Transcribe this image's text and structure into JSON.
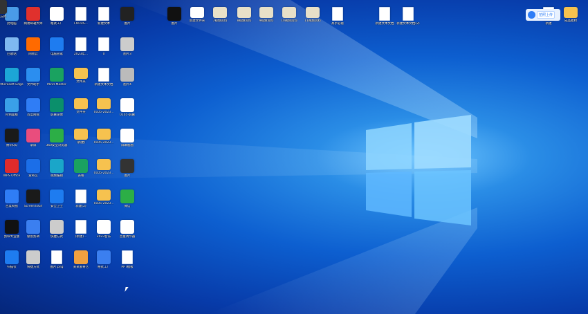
{
  "desktop_icons": [
    {
      "label": "此电脑",
      "icon": "computer-icon",
      "color": "#4a9be8"
    },
    {
      "label": "网易邮箱大师",
      "icon": "mail-icon",
      "color": "#e0312d"
    },
    {
      "label": "格式工厂",
      "icon": "factory-icon",
      "color": "#ffffff"
    },
    {
      "label": "FOCUS...",
      "icon": "document-icon",
      "color": "#ffffff"
    },
    {
      "label": "新建文本",
      "icon": "document-icon",
      "color": "#ffffff"
    },
    {
      "label": "图片",
      "icon": "phone-icon",
      "color": "#222222"
    },
    {
      "label": "回收站",
      "icon": "recycle-bin-icon",
      "color": "#7fb8f0"
    },
    {
      "label": "网易云",
      "icon": "music-icon",
      "color": "#ff6a00"
    },
    {
      "label": "电脑管家",
      "icon": "shield-icon",
      "color": "#1e7cf0"
    },
    {
      "label": "2023年...",
      "icon": "document-icon",
      "color": "#ffffff"
    },
    {
      "label": "0",
      "icon": "document-icon",
      "color": "#ffffff"
    },
    {
      "label": "图片3",
      "icon": "image-icon",
      "color": "#cccccc"
    },
    {
      "label": "Microsoft Edge",
      "icon": "edge-icon",
      "color": "#1ca6d6"
    },
    {
      "label": "文件助手",
      "icon": "link-icon",
      "color": "#2b8ef0"
    },
    {
      "label": "Mind Master",
      "icon": "mindmap-icon",
      "color": "#1aa260"
    },
    {
      "label": "文件夹",
      "icon": "folder-icon",
      "color": "#f6c24f"
    },
    {
      "label": "新建文本文档",
      "icon": "document-icon",
      "color": "#ffffff"
    },
    {
      "label": "图片4",
      "icon": "phone-icon",
      "color": "#bbbbbb"
    },
    {
      "label": "控制面板",
      "icon": "control-panel-icon",
      "color": "#3aa0e8"
    },
    {
      "label": "百度网盘",
      "icon": "cloud-icon",
      "color": "#2f7df6"
    },
    {
      "label": "屏幕录像",
      "icon": "monitor-icon",
      "color": "#0b8f6b"
    },
    {
      "label": "文件夹",
      "icon": "folder-icon",
      "color": "#f6c24f"
    },
    {
      "label": "0105-2023...",
      "icon": "folder-icon",
      "color": "#f6c24f"
    },
    {
      "label": "0105-屏幕",
      "icon": "laptop-icon",
      "color": "#ffffff"
    },
    {
      "label": "腾讯QQ",
      "icon": "qq-icon",
      "color": "#1a1a1a"
    },
    {
      "label": "录屏",
      "icon": "record-icon",
      "color": "#e94d7d"
    },
    {
      "label": "360安全浏览器",
      "icon": "browser-icon",
      "color": "#2cae46"
    },
    {
      "label": "(新建)",
      "icon": "folder-icon",
      "color": "#f6c24f"
    },
    {
      "label": "0105-2023...",
      "icon": "folder-icon",
      "color": "#f6c24f"
    },
    {
      "label": "屏幕截图",
      "icon": "laptop-icon",
      "color": "#ffffff"
    },
    {
      "label": "WPS Office",
      "icon": "wps-icon",
      "color": "#e02b2b"
    },
    {
      "label": "爱奇艺",
      "icon": "video-icon",
      "color": "#1b6ee8"
    },
    {
      "label": "视频编辑",
      "icon": "video-edit-icon",
      "color": "#1aa6c9"
    },
    {
      "label": "表格",
      "icon": "spreadsheet-icon",
      "color": "#1aa260"
    },
    {
      "label": "0105-2023...",
      "icon": "folder-icon",
      "color": "#f6c24f"
    },
    {
      "label": "图片",
      "icon": "phone-icon",
      "color": "#333333"
    },
    {
      "label": "百度网盘",
      "icon": "cloud-icon",
      "color": "#2f7df6"
    },
    {
      "label": "ScreenToGif",
      "icon": "monitor-icon",
      "color": "#1a1a1a"
    },
    {
      "label": "安全卫士",
      "icon": "shield-icon",
      "color": "#1e7cf0"
    },
    {
      "label": "新建(2)",
      "icon": "document-icon",
      "color": "#ffffff"
    },
    {
      "label": "0105-2023...",
      "icon": "folder-icon",
      "color": "#f6c24f"
    },
    {
      "label": "微信",
      "icon": "wechat-icon",
      "color": "#2cae46"
    },
    {
      "label": "剪映专业版",
      "icon": "capcut-icon",
      "color": "#111111"
    },
    {
      "label": "极客剪辑",
      "icon": "editor-icon",
      "color": "#3b7ff0"
    },
    {
      "label": "快捷方式",
      "icon": "shortcut-icon",
      "color": "#cccccc"
    },
    {
      "label": "(新建)...",
      "icon": "document-icon",
      "color": "#ffffff"
    },
    {
      "label": "2023音乐",
      "icon": "speaker-icon",
      "color": "#ffffff"
    },
    {
      "label": "音量调节器",
      "icon": "speaker-icon",
      "color": "#ffffff"
    },
    {
      "label": "扫描仪",
      "icon": "scanner-icon",
      "color": "#1e7cf0"
    },
    {
      "label": "快捷方式",
      "icon": "shortcut-icon",
      "color": "#cccccc"
    },
    {
      "label": "图片.png",
      "icon": "document-icon",
      "color": "#ffffff"
    },
    {
      "label": "某某爱奇艺",
      "icon": "photo-icon",
      "color": "#f0a040"
    },
    {
      "label": "格式工厂",
      "icon": "gear-icon",
      "color": "#3b7ff0"
    },
    {
      "label": "PPT模板",
      "icon": "document-icon",
      "color": "#ffffff"
    },
    {
      "label": "快捷方式",
      "icon": "phone-icon",
      "color": "#333333"
    },
    {
      "label": "图片",
      "icon": "phone-icon",
      "color": "#111111"
    },
    {
      "label": "新建文件夹",
      "icon": "folder-icon",
      "color": "#ffffff"
    },
    {
      "label": "7视频资料",
      "icon": "folder-icon",
      "color": "#e8e0c8"
    },
    {
      "label": "8视频资料",
      "icon": "folder-icon",
      "color": "#e8e0c8"
    },
    {
      "label": "9视频资料",
      "icon": "folder-icon",
      "color": "#e8e0c8"
    },
    {
      "label": "10视频资料",
      "icon": "folder-icon",
      "color": "#e8e0c8"
    },
    {
      "label": "11视频资料",
      "icon": "folder-icon",
      "color": "#e8e0c8"
    },
    {
      "label": "高手必看",
      "icon": "document-icon",
      "color": "#ffffff"
    },
    {
      "label": "新建文本文档",
      "icon": "document-icon",
      "color": "#ffffff"
    },
    {
      "label": "新建文本文档(2)",
      "icon": "document-icon",
      "color": "#ffffff"
    },
    {
      "label": "新建",
      "icon": "document-icon",
      "color": "#ffffff"
    },
    {
      "label": "成品素材",
      "icon": "folder-icon",
      "color": "#f6c24f"
    }
  ],
  "widget": {
    "button": "拍照上传"
  }
}
